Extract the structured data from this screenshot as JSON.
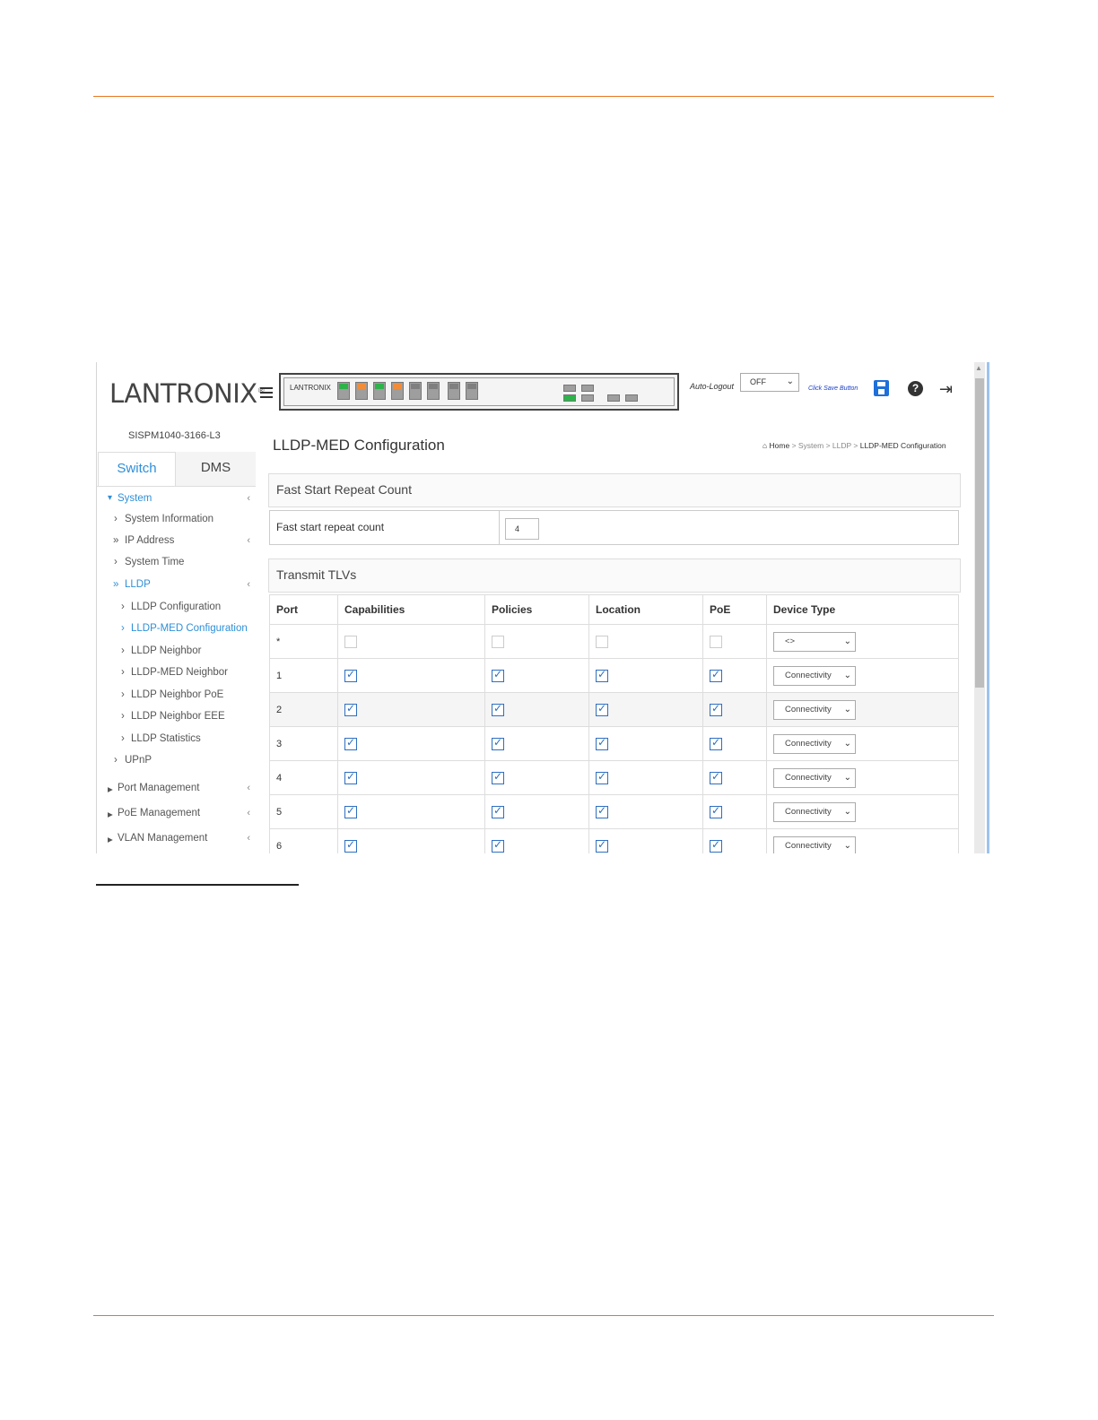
{
  "header": {
    "logo_text": "LANTRONIX",
    "panel_brand": "LANTRONIX",
    "auto_logout_label": "Auto-Logout",
    "auto_logout_value": "OFF",
    "save_hint": "Click Save Button",
    "icons": [
      "menu-icon",
      "save-icon",
      "help-icon",
      "logout-icon"
    ]
  },
  "sidebar": {
    "device_name": "SISPM1040-3166-L3",
    "tabs": [
      "Switch",
      "DMS"
    ],
    "items": [
      {
        "label": "System",
        "active": true
      },
      {
        "label": "System Information"
      },
      {
        "label": "IP Address"
      },
      {
        "label": "System Time"
      },
      {
        "label": "LLDP",
        "active": true
      },
      {
        "label": "LLDP Configuration"
      },
      {
        "label": "LLDP-MED Configuration",
        "active": true
      },
      {
        "label": "LLDP Neighbor"
      },
      {
        "label": "LLDP-MED Neighbor"
      },
      {
        "label": "LLDP Neighbor PoE"
      },
      {
        "label": "LLDP Neighbor EEE"
      },
      {
        "label": "LLDP Statistics"
      },
      {
        "label": "UPnP"
      },
      {
        "label": "Port Management"
      },
      {
        "label": "PoE Management"
      },
      {
        "label": "VLAN Management"
      }
    ]
  },
  "main": {
    "title": "LLDP-MED Configuration",
    "breadcrumb": [
      "Home",
      "System",
      "LLDP",
      "LLDP-MED Configuration"
    ],
    "fast_start": {
      "section_title": "Fast Start Repeat Count",
      "label": "Fast start repeat count",
      "value": "4"
    },
    "transmit": {
      "section_title": "Transmit TLVs",
      "columns": [
        "Port",
        "Capabilities",
        "Policies",
        "Location",
        "PoE",
        "Device Type"
      ],
      "wildcard_row": {
        "port": "*",
        "device_type": "<>"
      },
      "rows": [
        {
          "port": "1",
          "device_type": "Connectivity"
        },
        {
          "port": "2",
          "device_type": "Connectivity"
        },
        {
          "port": "3",
          "device_type": "Connectivity"
        },
        {
          "port": "4",
          "device_type": "Connectivity"
        },
        {
          "port": "5",
          "device_type": "Connectivity"
        },
        {
          "port": "6",
          "device_type": "Connectivity"
        }
      ]
    }
  },
  "colors": {
    "accent_rule": "#e87722",
    "link_blue": "#2e8fd8",
    "port_green": "#2db34a",
    "port_orange": "#f28c38"
  }
}
